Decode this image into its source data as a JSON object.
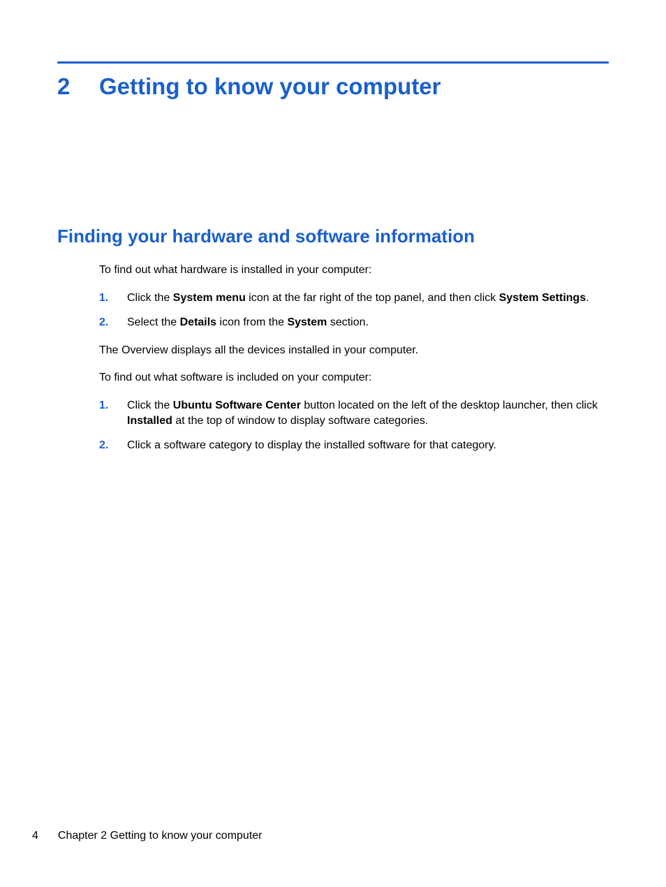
{
  "chapter": {
    "number": "2",
    "title": "Getting to know your computer"
  },
  "section": {
    "title": "Finding your hardware and software information"
  },
  "paragraphs": {
    "intro_hw": "To find out what hardware is installed in your computer:",
    "overview": "The Overview displays all the devices installed in your computer.",
    "intro_sw": "To find out what software is included on your computer:"
  },
  "list_hw": [
    {
      "num": "1.",
      "pre": "Click the ",
      "bold1": "System menu",
      "mid": " icon at the far right of the top panel, and then click ",
      "bold2": "System Settings",
      "post": "."
    },
    {
      "num": "2.",
      "pre": "Select the ",
      "bold1": "Details",
      "mid": " icon from the ",
      "bold2": "System",
      "post": " section."
    }
  ],
  "list_sw": [
    {
      "num": "1.",
      "pre": "Click the ",
      "bold1": "Ubuntu Software Center",
      "mid": " button located on the left of the desktop launcher, then click ",
      "bold2": "Installed",
      "post": " at the top of window to display software categories."
    },
    {
      "num": "2.",
      "pre": "",
      "bold1": "",
      "mid": "Click a software category to display the installed software for that category.",
      "bold2": "",
      "post": ""
    }
  ],
  "footer": {
    "page": "4",
    "chapter_label": "Chapter 2   Getting to know your computer"
  }
}
